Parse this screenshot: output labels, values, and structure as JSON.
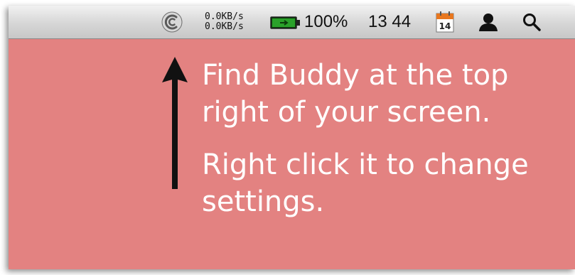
{
  "menubar": {
    "netspeed": {
      "upload": "0.0KB/s",
      "download": "0.0KB/s"
    },
    "battery": {
      "percent": "100%",
      "level": 1.0,
      "color": "#2aa12a"
    },
    "clock": "13 44",
    "calendar_day": "14",
    "icons": [
      "buddy-icon",
      "battery-icon",
      "calendar-icon",
      "user-icon",
      "search-icon"
    ]
  },
  "message": {
    "line1": "Find Buddy at the top right of your screen.",
    "line2": "Right click it to change settings."
  },
  "colors": {
    "background": "#e38281",
    "text": "#ffffff",
    "arrow": "#111111"
  }
}
